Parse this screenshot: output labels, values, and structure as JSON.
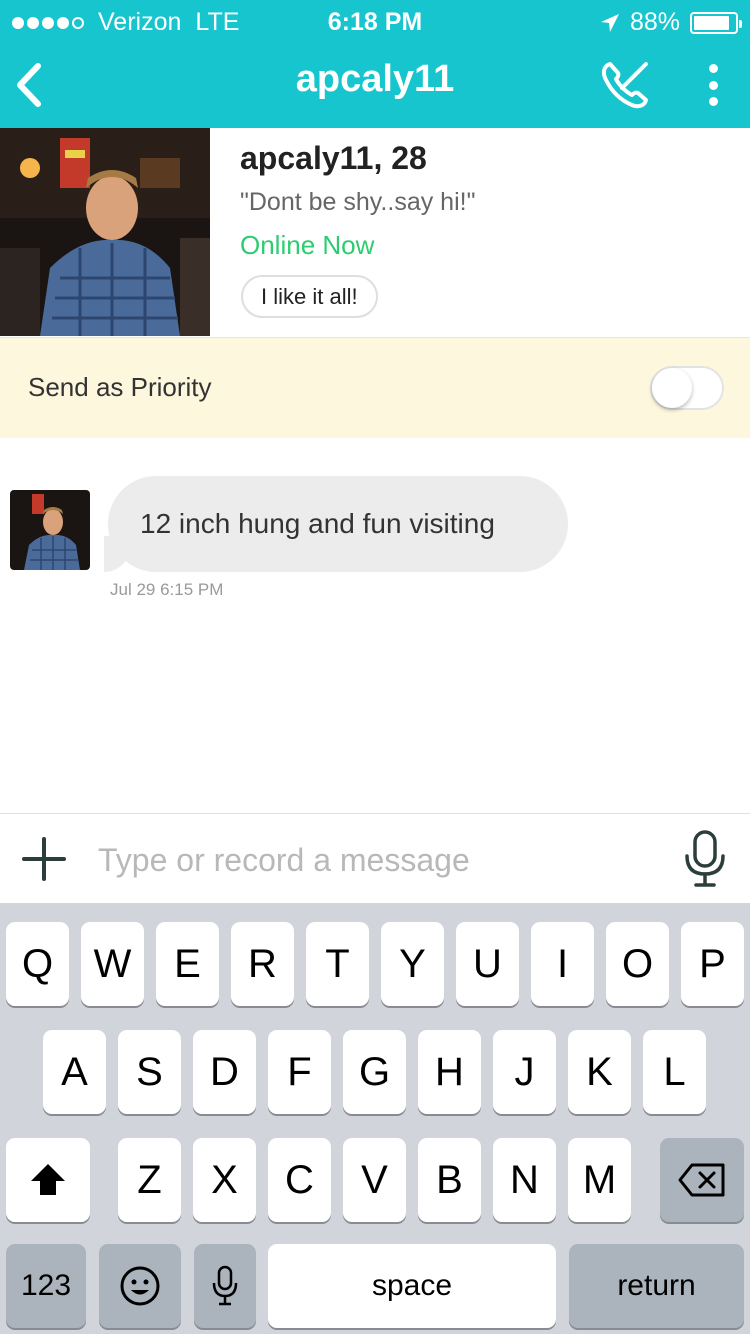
{
  "status_bar": {
    "carrier": "Verizon",
    "network": "LTE",
    "time": "6:18 PM",
    "battery": "88%",
    "battery_level": 0.88,
    "signal_bars": 4
  },
  "nav": {
    "title": "apcaly11",
    "back_icon": "chevron-left-icon",
    "call_icon": "phone-slash-icon",
    "more_icon": "vertical-dots-icon"
  },
  "profile": {
    "name_age": "apcaly11, 28",
    "tagline": "\"Dont be shy..say hi!\"",
    "status": "Online Now",
    "chip": "I like it all!"
  },
  "priority": {
    "label": "Send as Priority",
    "enabled": false
  },
  "messages": [
    {
      "text": "12 inch hung and fun visiting",
      "time": "Jul 29 6:15 PM"
    }
  ],
  "composer": {
    "placeholder": "Type or record a message",
    "value": ""
  },
  "keyboard": {
    "row1": [
      "Q",
      "W",
      "E",
      "R",
      "T",
      "Y",
      "U",
      "I",
      "O",
      "P"
    ],
    "row2": [
      "A",
      "S",
      "D",
      "F",
      "G",
      "H",
      "J",
      "K",
      "L"
    ],
    "row3": [
      "Z",
      "X",
      "C",
      "V",
      "B",
      "N",
      "M"
    ],
    "numbers": "123",
    "space": "space",
    "return": "return"
  },
  "colors": {
    "header": "#17c5cf",
    "online": "#2ecc71",
    "priority_bg": "#fdf7dd",
    "bubble": "#ececec"
  }
}
